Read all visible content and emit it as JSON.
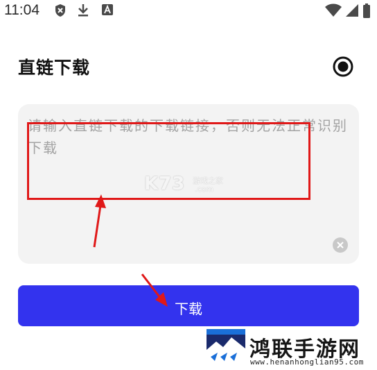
{
  "status_bar": {
    "time": "11:04"
  },
  "header": {
    "title": "直链下载"
  },
  "input": {
    "placeholder": "请输入直链下载的下载链接，否则无法正常识别下载"
  },
  "download_button": {
    "label": "下载"
  },
  "watermark": {
    "brand": "K73",
    "sub": "游戏之家",
    "domain": ".com"
  },
  "logo": {
    "name": "鸿联手游网",
    "url": "www.henanhonglian95.com"
  },
  "colors": {
    "accent": "#3333ee",
    "annotation": "#e01818",
    "card": "#f3f3f3"
  }
}
